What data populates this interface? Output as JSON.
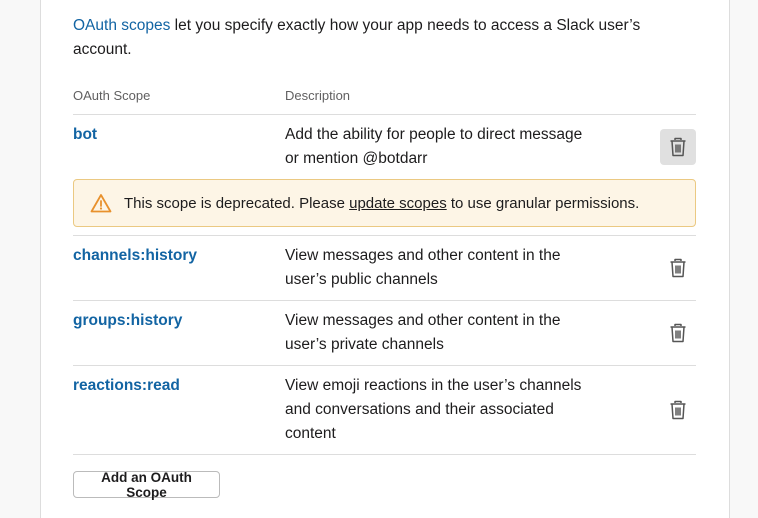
{
  "intro": {
    "link_text": "OAuth scopes",
    "text": " let you specify exactly how your app needs to access a Slack user’s account."
  },
  "table": {
    "columns": [
      "OAuth Scope",
      "Description"
    ],
    "rows": [
      {
        "scope": "bot",
        "description_lines": [
          "Add the ability for people to direct message",
          "or mention @botdarr"
        ],
        "delete_icon": "trash-icon"
      },
      {
        "scope": "channels:history",
        "description_lines": [
          "View messages and other content in the",
          "user’s public channels"
        ],
        "delete_icon": "trash-icon"
      },
      {
        "scope": "groups:history",
        "description_lines": [
          "View messages and other content in the",
          "user’s private channels"
        ],
        "delete_icon": "trash-icon"
      },
      {
        "scope": "reactions:read",
        "description_lines": [
          "View emoji reactions in the user’s channels",
          "and conversations and their associated",
          "content"
        ],
        "delete_icon": "trash-icon"
      }
    ]
  },
  "warning": {
    "icon": "warning-icon",
    "before": "This scope is deprecated. Please ",
    "link": "update scopes",
    "after": " to use granular permissions."
  },
  "add_button": "Add an OAuth Scope",
  "colors": {
    "link": "#1264a3",
    "warning_bg": "#fdf5e6",
    "warning_border": "#ebc982",
    "warning_icon": "#e8912d"
  }
}
